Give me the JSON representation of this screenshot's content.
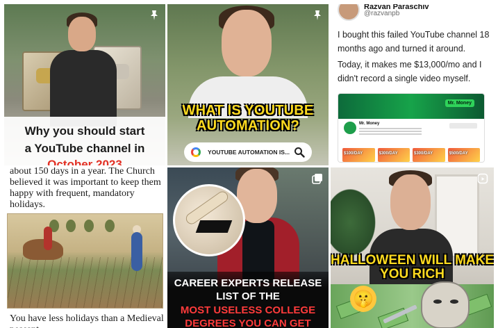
{
  "tiles": {
    "t1": {
      "caption_line1": "Why you should start",
      "caption_line2": "a YouTube channel in",
      "caption_line3": "October 2023"
    },
    "t2": {
      "headline": "WHAT IS YOUTUBE AUTOMATION?",
      "search_text": "YOUTUBE AUTOMATION IS..."
    },
    "t3": {
      "author_name": "Razvan Paraschiv",
      "author_handle": "@razvanpb",
      "tweet_line1": "I bought this failed YouTube channel 18 months ago and turned it around.",
      "tweet_line2": "Today, it makes me $13,000/mo and I didn't record a single video myself.",
      "banner_label": "Mr. Money",
      "channel_name": "Mr. Money",
      "thumb_labels": [
        "$100/DAY",
        "$300/DAY",
        "$300/DAY",
        "$500/DAY"
      ]
    },
    "t4": {
      "text_top": "about 150 days in a year. The Church believed it was important to keep them happy with frequent, mandatory holidays.",
      "text_bottom": "You have less holidays than a Medieval peasant"
    },
    "t5": {
      "caption_white": "CAREER EXPERTS RELEASE LIST OF THE",
      "caption_red": "MOST USELESS COLLEGE DEGREES YOU CAN GET"
    },
    "t6": {
      "headline": "HALLOWEEN WILL MAKE YOU RICH",
      "emoji": "🤫"
    }
  },
  "icons": {
    "pin": "pin-icon",
    "multi": "carousel-icon",
    "search": "magnifier-icon",
    "google": "google-icon"
  },
  "colors": {
    "yellow_headline": "#ffdb1f",
    "red_caption": "#e23024",
    "red_bold": "#ff3b3b"
  }
}
